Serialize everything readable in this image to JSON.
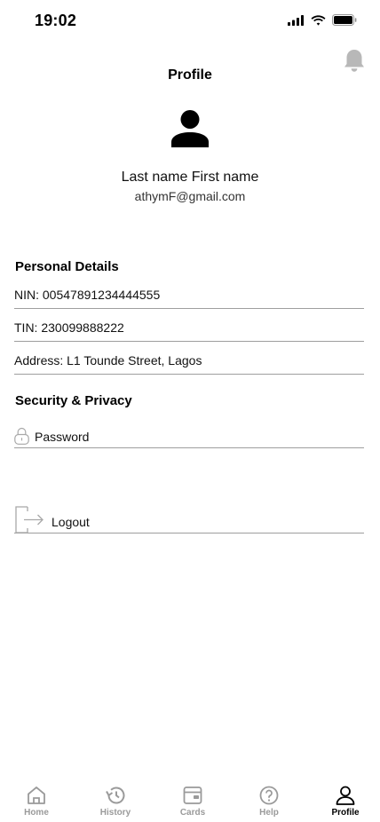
{
  "status_bar": {
    "time": "19:02"
  },
  "header": {
    "title": "Profile"
  },
  "user": {
    "name": "Last name First name",
    "email": "athymF@gmail.com"
  },
  "personal_details": {
    "title": "Personal Details",
    "nin": "NIN: 00547891234444555",
    "tin": "TIN: 230099888222",
    "address": "Address: L1 Tounde Street, Lagos"
  },
  "security": {
    "title": "Security & Privacy",
    "password_label": "Password"
  },
  "logout": {
    "label": "Logout"
  },
  "nav": {
    "home": "Home",
    "history": "History",
    "cards": "Cards",
    "help": "Help",
    "profile": "Profile",
    "active": "Profile"
  },
  "colors": {
    "text": "#111111",
    "divider": "#9e9e9e",
    "inactive": "#9a9a9a",
    "bell": "#b8b8b8"
  }
}
